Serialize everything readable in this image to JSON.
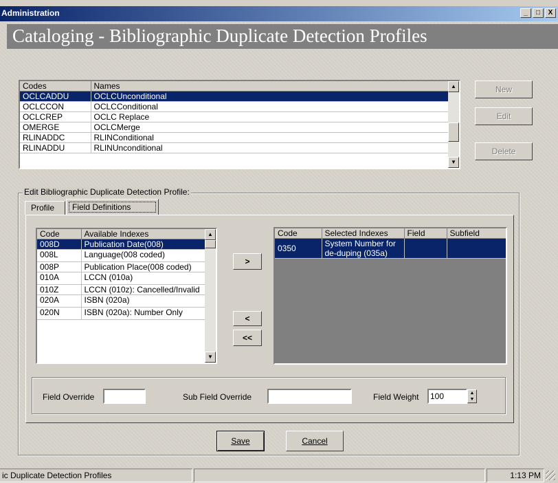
{
  "window": {
    "title": "Administration",
    "controls": [
      "_",
      "□",
      "X"
    ]
  },
  "header": {
    "title": "Cataloging - Bibliographic Duplicate Detection Profiles"
  },
  "profiles": {
    "columns": [
      "Codes",
      "Names"
    ],
    "rows": [
      {
        "code": "OCLCADDU",
        "name": "OCLCUnconditional",
        "selected": true
      },
      {
        "code": "OCLCCON",
        "name": "OCLCConditional"
      },
      {
        "code": "OCLCREP",
        "name": "OCLC Replace"
      },
      {
        "code": "OMERGE",
        "name": "OCLCMerge"
      },
      {
        "code": "RLINADDC",
        "name": "RLINConditional"
      },
      {
        "code": "RLINADDU",
        "name": "RLINUnconditional"
      }
    ]
  },
  "actions": {
    "new": "New",
    "edit": "Edit",
    "delete": "Delete"
  },
  "edit_group": {
    "label": "Edit  Bibliographic Duplicate Detection Profile:",
    "tabs": [
      "Profile",
      "Field Definitions"
    ],
    "active_tab": "Field Definitions"
  },
  "available": {
    "columns": [
      "Code",
      "Available Indexes"
    ],
    "rows": [
      {
        "code": "008D",
        "name": "Publication Date(008)",
        "selected": true
      },
      {
        "code": "008L",
        "name": "Language(008 coded)"
      },
      {
        "code": "008P",
        "name": "Publication Place(008 coded)"
      },
      {
        "code": "010A",
        "name": "LCCN (010a)"
      },
      {
        "code": "010Z",
        "name": "LCCN (010z): Cancelled/Invalid"
      },
      {
        "code": "020A",
        "name": "ISBN (020a)"
      },
      {
        "code": "020N",
        "name": "ISBN (020a): Number Only"
      }
    ]
  },
  "move_buttons": {
    "add": ">",
    "remove": "<",
    "remove_all": "<<"
  },
  "selected": {
    "columns": [
      "Code",
      "Selected Indexes",
      "Field",
      "Subfield"
    ],
    "rows": [
      {
        "code": "0350",
        "name": "System Number for de-duping (035a)",
        "field": "",
        "subfield": "",
        "selected": true
      }
    ]
  },
  "overrides": {
    "field_override_label": "Field Override",
    "field_override_value": "",
    "subfield_override_label": "Sub Field Override",
    "subfield_override_value": "",
    "field_weight_label": "Field Weight",
    "field_weight_value": "100"
  },
  "footer_buttons": {
    "save": "Save",
    "cancel": "Cancel"
  },
  "statusbar": {
    "text": "ic Duplicate Detection Profiles",
    "time": "1:13 PM"
  },
  "colors": {
    "selection": "#0a246a",
    "header": "#808080",
    "face": "#d4d0c8"
  }
}
